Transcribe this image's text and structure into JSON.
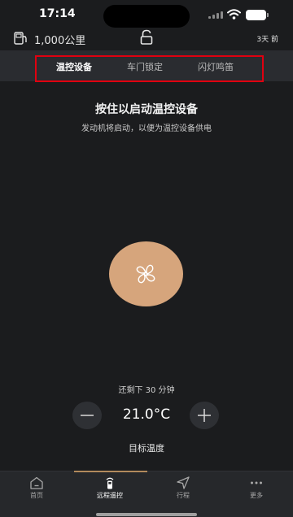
{
  "status_bar": {
    "time": "17:14"
  },
  "info": {
    "mileage": "1,000公里",
    "days_label": "3天 前"
  },
  "tabs": [
    {
      "label": "温控设备",
      "active": true
    },
    {
      "label": "车门锁定",
      "active": false
    },
    {
      "label": "闪灯鸣笛",
      "active": false
    }
  ],
  "climate": {
    "heading": "按住以启动温控设备",
    "subheading": "发动机将启动，以便为温控设备供电",
    "remaining": "还剩下 30 分钟",
    "temperature": "21.0°C",
    "target_label": "目标温度",
    "button_color": "#d6a57c"
  },
  "highlight_color": "#e00010",
  "nav": [
    {
      "label": "首页",
      "icon": "home-icon",
      "active": false
    },
    {
      "label": "远程遥控",
      "icon": "remote-icon",
      "active": true
    },
    {
      "label": "行程",
      "icon": "navigation-icon",
      "active": false
    },
    {
      "label": "更多",
      "icon": "more-icon",
      "active": false
    }
  ]
}
